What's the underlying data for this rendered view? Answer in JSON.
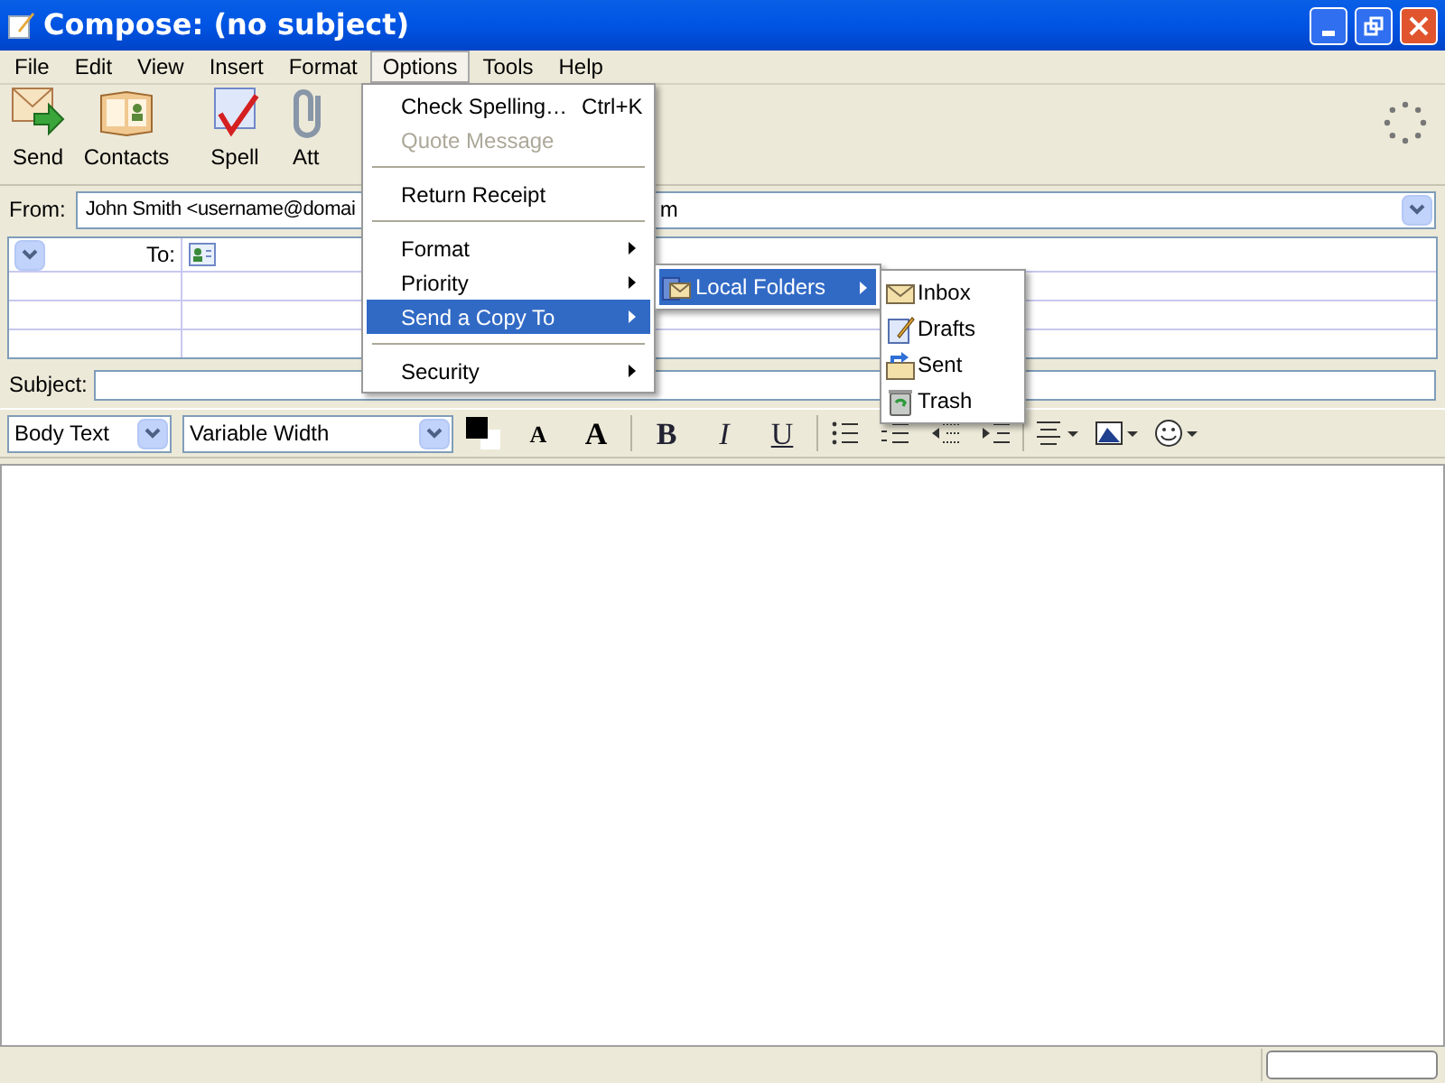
{
  "window": {
    "title": "Compose: (no subject)"
  },
  "menubar": [
    {
      "label": "File",
      "selected": false
    },
    {
      "label": "Edit",
      "selected": false
    },
    {
      "label": "View",
      "selected": false
    },
    {
      "label": "Insert",
      "selected": false
    },
    {
      "label": "Format",
      "selected": false
    },
    {
      "label": "Options",
      "selected": true
    },
    {
      "label": "Tools",
      "selected": false
    },
    {
      "label": "Help",
      "selected": false
    }
  ],
  "toolbar": [
    {
      "label": "Send"
    },
    {
      "label": "Contacts"
    },
    {
      "label": "Spell"
    },
    {
      "label": "Att"
    }
  ],
  "from": {
    "label": "From:",
    "value": "John Smith <username@domai",
    "value_end": "m"
  },
  "addressing": {
    "type_label": "To:"
  },
  "subject": {
    "label": "Subject:"
  },
  "format_bar": {
    "paragraph": "Body Text",
    "font": "Variable Width",
    "buttons": [
      {
        "kind": "smaller",
        "label": "A"
      },
      {
        "kind": "larger",
        "label": "A"
      },
      {
        "kind": "bold",
        "label": "B"
      },
      {
        "kind": "italic",
        "label": "I"
      },
      {
        "kind": "underline",
        "label": "U"
      }
    ]
  },
  "options_menu": [
    {
      "kind": "item",
      "label": "Check Spelling…",
      "shortcut": "Ctrl+K",
      "submenu": false,
      "disabled": false,
      "selected": false
    },
    {
      "kind": "item",
      "label": "Quote Message",
      "submenu": false,
      "disabled": true,
      "selected": false
    },
    {
      "kind": "separator"
    },
    {
      "kind": "item",
      "label": "Return Receipt",
      "submenu": false,
      "disabled": false,
      "selected": false
    },
    {
      "kind": "separator"
    },
    {
      "kind": "item",
      "label": "Format",
      "submenu": true,
      "disabled": false,
      "selected": false
    },
    {
      "kind": "item",
      "label": "Priority",
      "submenu": true,
      "disabled": false,
      "selected": false
    },
    {
      "kind": "item",
      "label": "Send a Copy To",
      "submenu": true,
      "disabled": false,
      "selected": true
    },
    {
      "kind": "separator"
    },
    {
      "kind": "item",
      "label": "Security",
      "submenu": true,
      "disabled": false,
      "selected": false
    }
  ],
  "copy_menu": [
    {
      "label": "Local Folders",
      "selected": true
    }
  ],
  "folder_menu": [
    {
      "label": "Inbox",
      "selected": false
    },
    {
      "label": "Drafts",
      "selected": false
    },
    {
      "label": "Sent",
      "selected": false
    },
    {
      "label": "Trash",
      "selected": false
    }
  ]
}
